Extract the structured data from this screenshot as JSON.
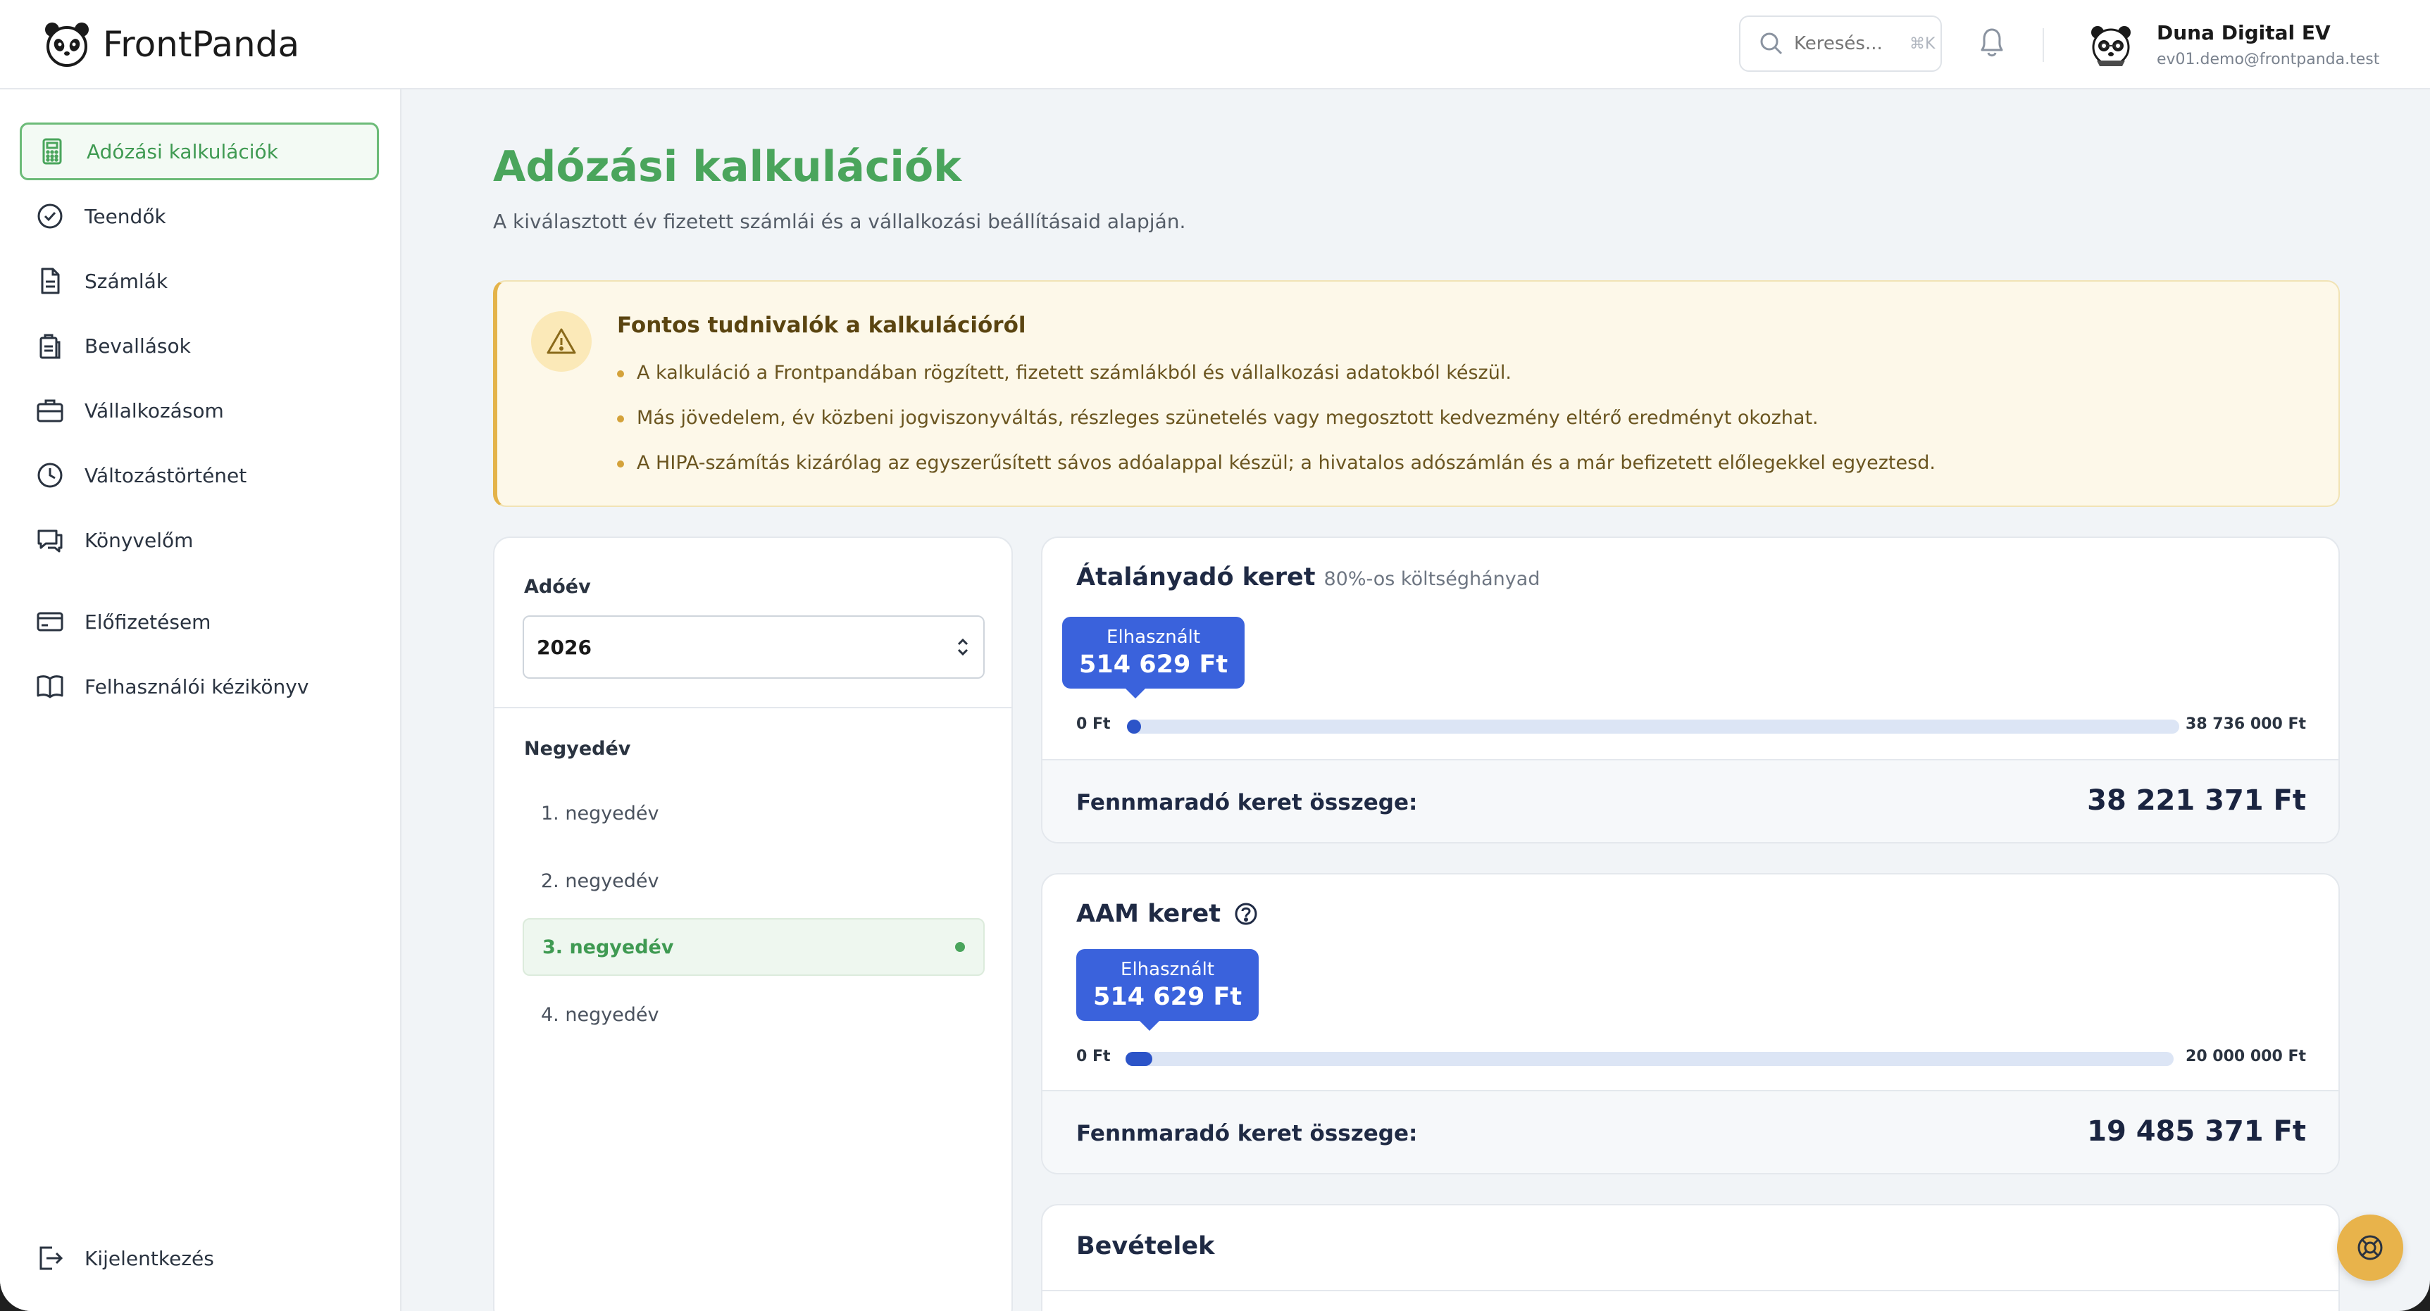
{
  "app": {
    "name": "FrontPanda"
  },
  "header": {
    "search_placeholder": "Keresés...",
    "search_shortcut": "⌘K",
    "user_name": "Duna Digital EV",
    "user_email": "ev01.demo@frontpanda.test"
  },
  "sidebar": {
    "items": [
      {
        "label": "Adózási kalkulációk",
        "icon": "calculator-icon",
        "active": true
      },
      {
        "label": "Teendők",
        "icon": "check-circle-icon"
      },
      {
        "label": "Számlák",
        "icon": "document-icon"
      },
      {
        "label": "Bevallások",
        "icon": "clipboard-icon"
      },
      {
        "label": "Vállalkozásom",
        "icon": "briefcase-icon"
      },
      {
        "label": "Változástörténet",
        "icon": "clock-icon"
      },
      {
        "label": "Könyvelőm",
        "icon": "chat-icon"
      },
      {
        "label": "Előfizetésem",
        "icon": "credit-card-icon"
      },
      {
        "label": "Felhasználói kézikönyv",
        "icon": "book-icon"
      }
    ],
    "logout_label": "Kijelentkezés"
  },
  "page": {
    "title": "Adózási kalkulációk",
    "subtitle": "A kiválasztott év fizetett számlái és a vállalkozási beállításaid alapján."
  },
  "notice": {
    "title": "Fontos tudnivalók a kalkulációról",
    "items": [
      "A kalkuláció a Frontpandában rögzített, fizetett számlákból és vállalkozási adatokból készül.",
      "Más jövedelem, év közbeni jogviszonyváltás, részleges szünetelés vagy megosztott kedvezmény eltérő eredményt okozhat.",
      "A HIPA-számítás kizárólag az egyszerűsített sávos adóalappal készül; a hivatalos adószámlán és a már befizetett előlegekkel egyeztesd."
    ]
  },
  "filters": {
    "year_label": "Adóév",
    "year_value": "2026",
    "quarter_label": "Negyedév",
    "quarters": [
      {
        "label": "1. negyedév",
        "active": false
      },
      {
        "label": "2. negyedév",
        "active": false
      },
      {
        "label": "3. negyedév",
        "active": true
      },
      {
        "label": "4. negyedév",
        "active": false
      }
    ]
  },
  "cards": {
    "atalanyado": {
      "title": "Átalányadó keret",
      "subtitle": "80%-os költséghányad",
      "used_label": "Elhasznált",
      "used_value": "514 629 Ft",
      "min_label": "0 Ft",
      "max_label": "38 736 000 Ft",
      "used_fraction": 0.0133,
      "remaining_label": "Fennmaradó keret összege:",
      "remaining_value": "38 221 371 Ft"
    },
    "aam": {
      "title": "AAM keret",
      "used_label": "Elhasznált",
      "used_value": "514 629 Ft",
      "min_label": "0 Ft",
      "max_label": "20 000 000 Ft",
      "used_fraction": 0.0257,
      "remaining_label": "Fennmaradó keret összege:",
      "remaining_value": "19 485 371 Ft"
    },
    "bevetelek": {
      "title": "Bevételek"
    }
  },
  "colors": {
    "brand_green": "#4aa55c",
    "accent_blue": "#3a62dc",
    "notice_bg": "#fdf8e9",
    "fab": "#e8b34b"
  }
}
